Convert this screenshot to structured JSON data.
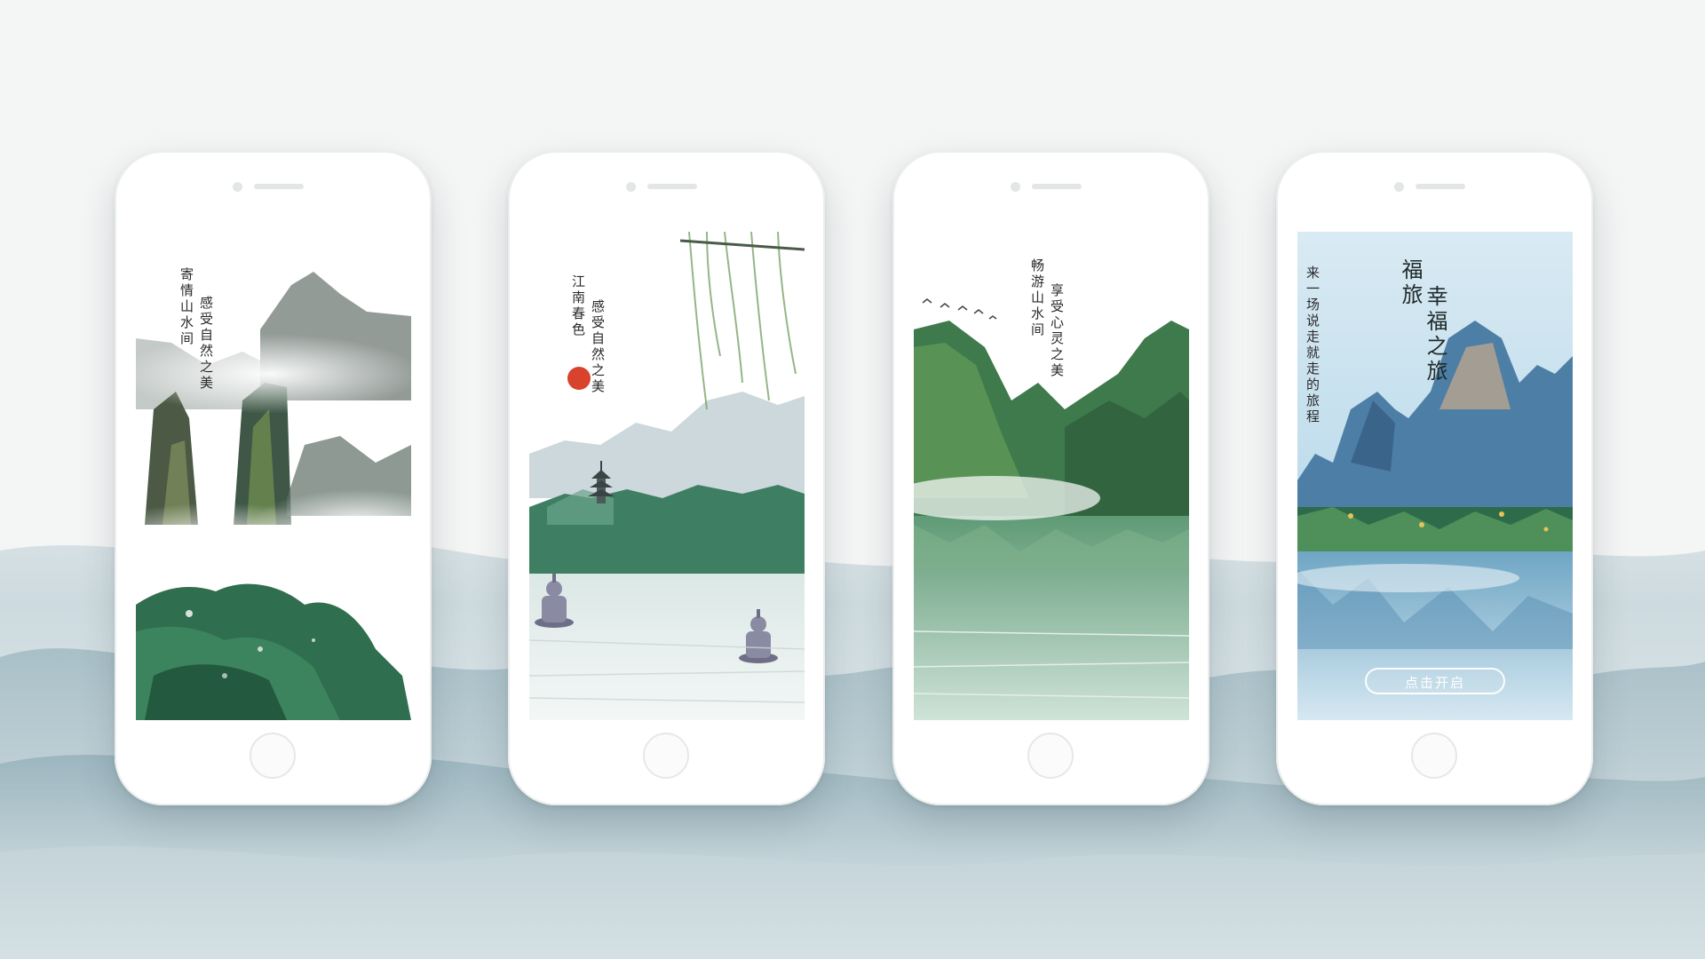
{
  "screens": [
    {
      "lines": [
        "寄情山水间",
        "感受自然之美"
      ]
    },
    {
      "lines": [
        "江南春色",
        "感受自然之美"
      ]
    },
    {
      "lines": [
        "畅游山水间",
        "享受心灵之美"
      ]
    },
    {
      "title_lines": [
        "福旅",
        "幸福之旅"
      ],
      "subtitle": "来一场说走就走的旅程",
      "button_label": "点击开启"
    }
  ],
  "colors": {
    "background": "#f4f5f5",
    "mist_mountains": "#9db6bf",
    "ink_green": "#2f6e4e",
    "sun_red": "#d9422c",
    "sky_blue": "#8fbfdc"
  },
  "icons": [
    "camera-icon",
    "speaker-icon",
    "home-button-icon",
    "sun-icon",
    "pagoda-icon",
    "stone-lantern-icon",
    "birds-icon"
  ]
}
